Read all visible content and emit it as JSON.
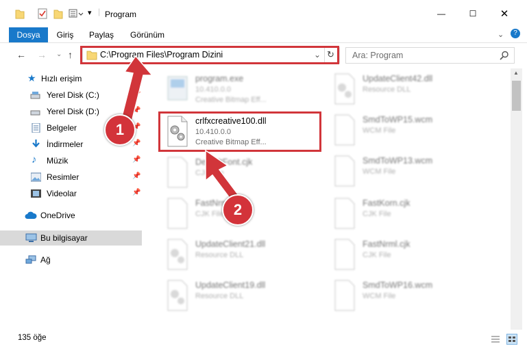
{
  "window": {
    "title": "Program",
    "controls": {
      "minimize": "—",
      "maximize": "☐",
      "close": "✕"
    }
  },
  "ribbon": {
    "tabs": [
      "Dosya",
      "Giriş",
      "Paylaş",
      "Görünüm"
    ],
    "expand_icon": "?"
  },
  "address": {
    "path": "C:\\Program Files\\Program Dizini",
    "search_placeholder": "Ara: Program"
  },
  "sidebar": {
    "items": [
      {
        "label": "Hızlı erişim",
        "icon": "star-icon",
        "pinned": false
      },
      {
        "label": "Yerel Disk (C:)",
        "icon": "drive-icon",
        "pinned": true
      },
      {
        "label": "Yerel Disk (D:)",
        "icon": "drive-icon",
        "pinned": true
      },
      {
        "label": "Belgeler",
        "icon": "documents-icon",
        "pinned": true
      },
      {
        "label": "İndirmeler",
        "icon": "download-icon",
        "pinned": true
      },
      {
        "label": "Müzik",
        "icon": "music-icon",
        "pinned": true
      },
      {
        "label": "Resimler",
        "icon": "pictures-icon",
        "pinned": true
      },
      {
        "label": "Videolar",
        "icon": "video-icon",
        "pinned": true
      },
      {
        "label": "OneDrive",
        "icon": "cloud-icon",
        "pinned": false
      },
      {
        "label": "Bu bilgisayar",
        "icon": "computer-icon",
        "pinned": false,
        "selected": true
      },
      {
        "label": "Ağ",
        "icon": "network-icon",
        "pinned": false
      }
    ]
  },
  "files": {
    "left": [
      {
        "name": "program.exe",
        "line1": "10.410.0.0",
        "line2": "Creative Bitmap Eff...",
        "highlight": false
      },
      {
        "name": "crlfxcreative100.dll",
        "line1": "10.410.0.0",
        "line2": "Creative Bitmap Eff...",
        "highlight": true
      },
      {
        "name": "DefaultFont.cjk",
        "line1": "CJK File",
        "line2": "",
        "highlight": false
      },
      {
        "name": "FastNrml.cjk",
        "line1": "CJK File",
        "line2": "",
        "highlight": false
      },
      {
        "name": "UpdateClient21.dll",
        "line1": "Resource DLL",
        "line2": "",
        "highlight": false
      },
      {
        "name": "UpdateClient19.dll",
        "line1": "Resource DLL",
        "line2": "",
        "highlight": false
      }
    ],
    "right": [
      {
        "name": "UpdateClient42.dll",
        "line1": "Resource DLL",
        "line2": ""
      },
      {
        "name": "SmdToWP15.wcm",
        "line1": "WCM File",
        "line2": ""
      },
      {
        "name": "SmdToWP13.wcm",
        "line1": "WCM File",
        "line2": ""
      },
      {
        "name": "FastKorn.cjk",
        "line1": "CJK File",
        "line2": ""
      },
      {
        "name": "FastNrml.cjk",
        "line1": "CJK File",
        "line2": ""
      },
      {
        "name": "SmdToWP16.wcm",
        "line1": "WCM File",
        "line2": ""
      }
    ]
  },
  "status": {
    "count": "135 öğe"
  },
  "annotations": {
    "step1": "1",
    "step2": "2"
  },
  "colors": {
    "accent": "#1979ca",
    "annotation": "#d1353a",
    "selected": "#d9d9d9"
  }
}
